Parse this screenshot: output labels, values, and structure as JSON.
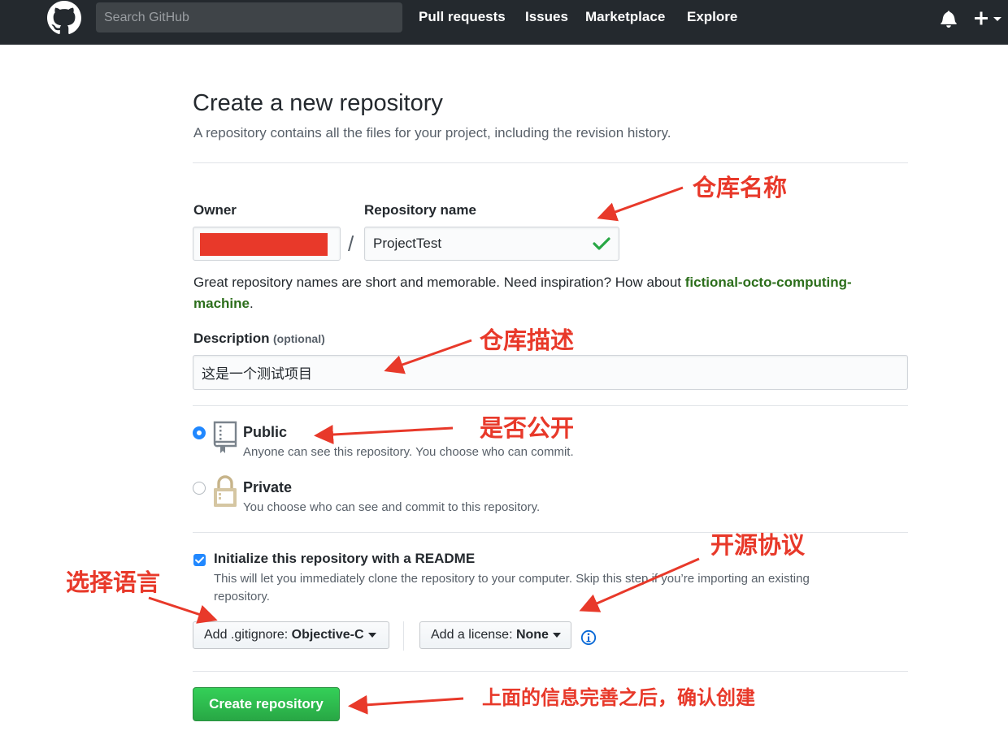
{
  "header": {
    "search_placeholder": "Search GitHub",
    "nav": [
      "Pull requests",
      "Issues",
      "Marketplace",
      "Explore"
    ]
  },
  "page": {
    "title": "Create a new repository",
    "subtitle": "A repository contains all the files for your project, including the revision history."
  },
  "form": {
    "owner_label": "Owner",
    "repo_label": "Repository name",
    "repo_value": "ProjectTest",
    "separator": "/",
    "hint_text": "Great repository names are short and memorable. Need inspiration? How about ",
    "hint_suggestion_1": "fictional-octo-computing-",
    "hint_suggestion_2": "machine",
    "hint_end": ".",
    "description_label": "Description",
    "description_optional": "(optional)",
    "description_value": "这是一个测试项目",
    "public_title": "Public",
    "public_desc": "Anyone can see this repository. You choose who can commit.",
    "private_title": "Private",
    "private_desc": "You choose who can see and commit to this repository.",
    "readme_title": "Initialize this repository with a README",
    "readme_desc_1": "This will let you immediately clone the repository to your computer. Skip this step if you’re importing an existing",
    "readme_desc_2": "repository.",
    "gitignore_prefix": "Add .gitignore: ",
    "gitignore_value": "Objective-C",
    "license_prefix": "Add a license: ",
    "license_value": "None",
    "create_button": "Create repository"
  },
  "annotations": {
    "repo_name": "仓库名称",
    "description": "仓库描述",
    "visibility": "是否公开",
    "license": "开源协议",
    "language": "选择语言",
    "confirm": "上面的信息完善之后，确认创建"
  },
  "colors": {
    "header_bg": "#24292e",
    "primary_button": "#28a745",
    "annotation_red": "#e8392a",
    "radio_selected": "#2188ff",
    "suggestion_green": "#2c6e1b"
  }
}
